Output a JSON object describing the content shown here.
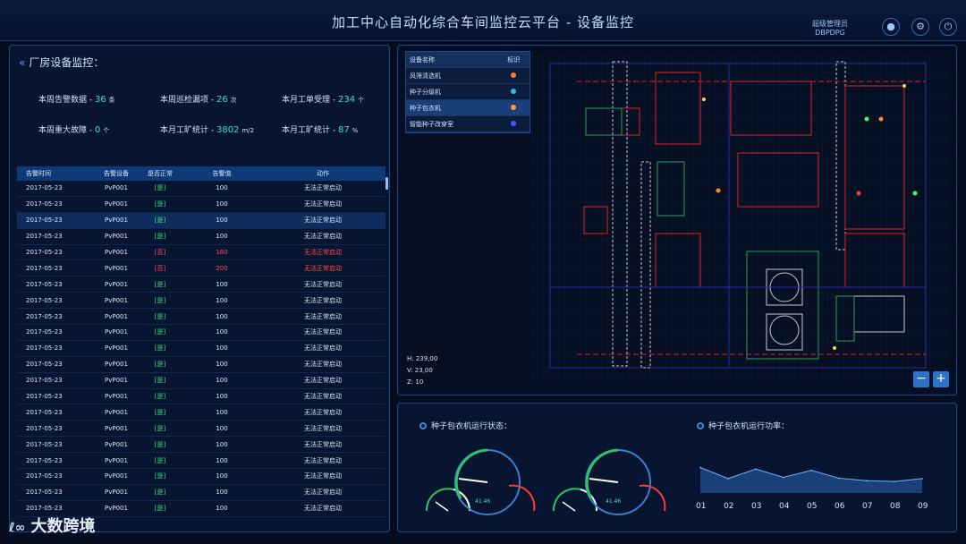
{
  "header": {
    "title": "加工中心自动化综合车间监控云平台 - 设备监控",
    "user_name": "超级管理员",
    "user_id": "DBPDPG",
    "icons": [
      "user-icon",
      "gear-icon",
      "power-icon"
    ]
  },
  "left": {
    "title": "厂房设备监控：",
    "stats": [
      {
        "label": "本周告警数据 - ",
        "value": "36",
        "unit": "条"
      },
      {
        "label": "本周巡检漏项 - ",
        "value": "26",
        "unit": "次"
      },
      {
        "label": "本月工单受理 - ",
        "value": "234",
        "unit": "个"
      },
      {
        "label": "本周重大故障 - ",
        "value": "0",
        "unit": "个"
      },
      {
        "label": "本月工旷统计 - ",
        "value": "3802",
        "unit": "m/2"
      },
      {
        "label": "本月工旷统计 - ",
        "value": "87",
        "unit": "%"
      }
    ],
    "table": {
      "headers": [
        "告警时间",
        "告警设备",
        "是否正常",
        "告警值",
        "动作"
      ],
      "rows": [
        [
          "2017-05-23",
          "PvP001",
          "[是]",
          "100",
          "无法正常启动"
        ],
        [
          "2017-05-23",
          "PvP001",
          "[是]",
          "100",
          "无法正常启动"
        ],
        [
          "2017-05-23",
          "PvP001",
          "[是]",
          "100",
          "无法正常启动"
        ],
        [
          "2017-05-23",
          "PvP001",
          "[是]",
          "100",
          "无法正常启动"
        ],
        [
          "2017-05-23",
          "PvP001",
          "[否]",
          "180",
          "无法正常启动"
        ],
        [
          "2017-05-23",
          "PvP001",
          "[否]",
          "200",
          "无法正常启动"
        ],
        [
          "2017-05-23",
          "PvP001",
          "[是]",
          "100",
          "无法正常启动"
        ],
        [
          "2017-05-23",
          "PvP001",
          "[是]",
          "100",
          "无法正常启动"
        ],
        [
          "2017-05-23",
          "PvP001",
          "[是]",
          "100",
          "无法正常启动"
        ],
        [
          "2017-05-23",
          "PvP001",
          "[是]",
          "100",
          "无法正常启动"
        ],
        [
          "2017-05-23",
          "PvP001",
          "[是]",
          "100",
          "无法正常启动"
        ],
        [
          "2017-05-23",
          "PvP001",
          "[是]",
          "100",
          "无法正常启动"
        ],
        [
          "2017-05-23",
          "PvP001",
          "[是]",
          "100",
          "无法正常启动"
        ],
        [
          "2017-05-23",
          "PvP001",
          "[是]",
          "100",
          "无法正常启动"
        ],
        [
          "2017-05-23",
          "PvP001",
          "[是]",
          "100",
          "无法正常启动"
        ],
        [
          "2017-05-23",
          "PvP001",
          "[是]",
          "100",
          "无法正常启动"
        ],
        [
          "2017-05-23",
          "PvP001",
          "[是]",
          "100",
          "无法正常启动"
        ],
        [
          "2017-05-23",
          "PvP001",
          "[是]",
          "100",
          "无法正常启动"
        ],
        [
          "2017-05-23",
          "PvP001",
          "[是]",
          "100",
          "无法正常启动"
        ],
        [
          "2017-05-23",
          "PvP001",
          "[是]",
          "100",
          "无法正常启动"
        ],
        [
          "2017-05-23",
          "PvP001",
          "[是]",
          "100",
          "无法正常启动"
        ]
      ]
    }
  },
  "map": {
    "legend_headers": [
      "设备名称",
      "标识"
    ],
    "legend": [
      {
        "name": "风筛清选机",
        "color": "#ff7a2a"
      },
      {
        "name": "种子分级机",
        "color": "#34b6e6"
      },
      {
        "name": "种子包衣机",
        "color": "#ff9a3a"
      },
      {
        "name": "智能种子改穿室",
        "color": "#4a52ff"
      }
    ],
    "coords": [
      "H: 239,00",
      "V: 23,00",
      "Z: 10"
    ],
    "zoom": [
      "−",
      "+"
    ]
  },
  "bottom": {
    "status_title": "种子包衣机运行状态：",
    "power_title": "种子包衣机运行功率：",
    "gauge_value": "41.46",
    "chart_data": {
      "type": "area",
      "categories": [
        "01",
        "02",
        "03",
        "04",
        "05",
        "06",
        "07",
        "08",
        "09"
      ],
      "values": [
        62,
        35,
        58,
        38,
        55,
        36,
        30,
        28,
        35
      ],
      "ylim": [
        0,
        100
      ]
    }
  },
  "watermark": "大数跨境"
}
